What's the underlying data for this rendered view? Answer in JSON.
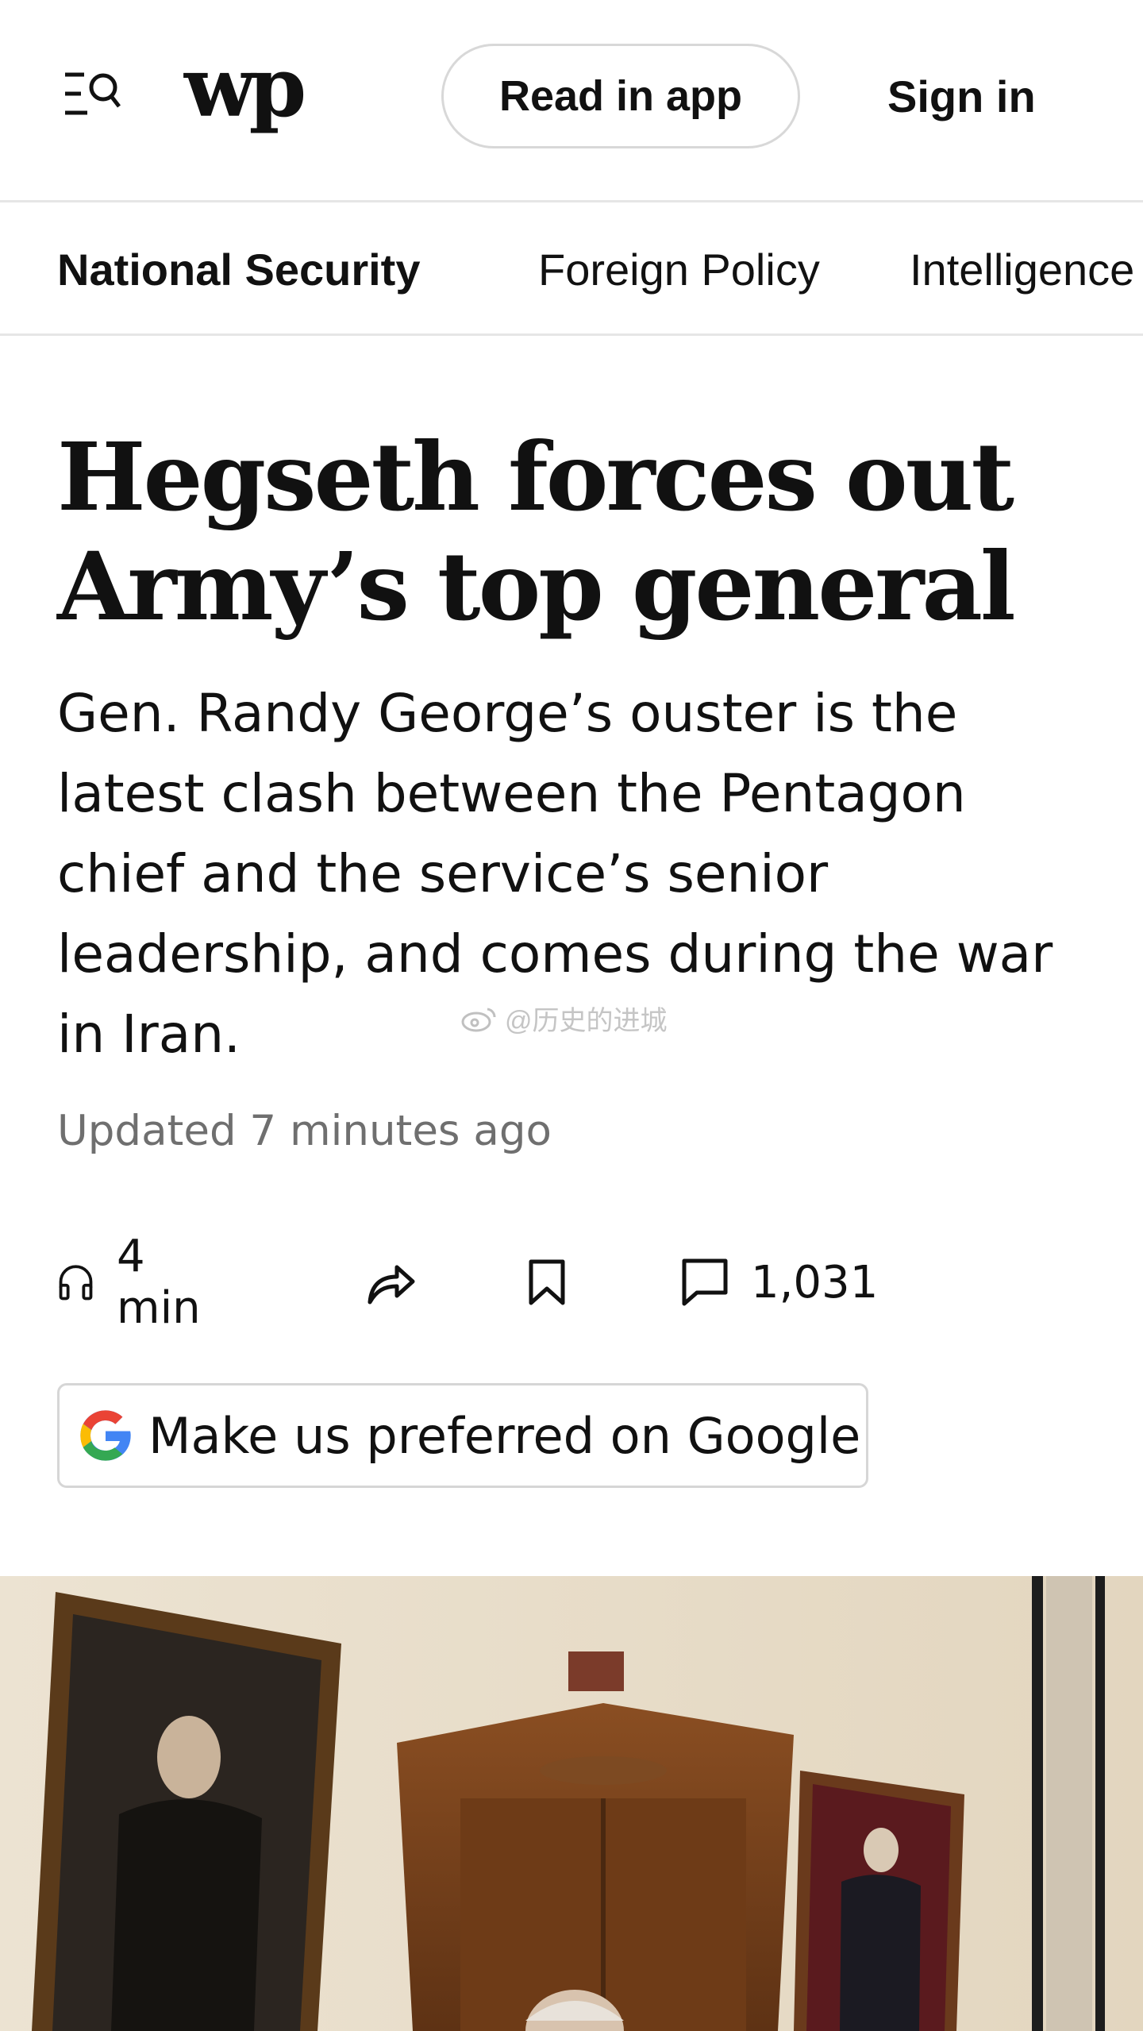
{
  "header": {
    "logo": "wp",
    "read_in_app": "Read in app",
    "sign_in": "Sign in"
  },
  "subnav": {
    "items": [
      "National Security",
      "Foreign Policy",
      "Intelligence"
    ],
    "active_index": 0
  },
  "article": {
    "headline": "Hegseth forces out Army’s top general",
    "dek": "Gen. Randy George’s ouster is the latest clash between the Pentagon chief and the service’s senior leadership, and comes during the war in Iran.",
    "timestamp": "Updated 7 minutes ago"
  },
  "actions": {
    "listen_label": "4 min",
    "comments_count": "1,031",
    "icons": [
      "headphones-icon",
      "share-icon",
      "bookmark-icon",
      "comment-icon"
    ]
  },
  "google_preferred": {
    "label": "Make us preferred on Google",
    "icon": "google-g-icon"
  },
  "watermark": {
    "text": "@历史的进城"
  },
  "colors": {
    "text": "#111111",
    "muted": "#6f6f6f",
    "divider": "#e6e6e6",
    "google_blue": "#4285F4",
    "google_red": "#EA4335",
    "google_yellow": "#FBBC05",
    "google_green": "#34A853"
  }
}
